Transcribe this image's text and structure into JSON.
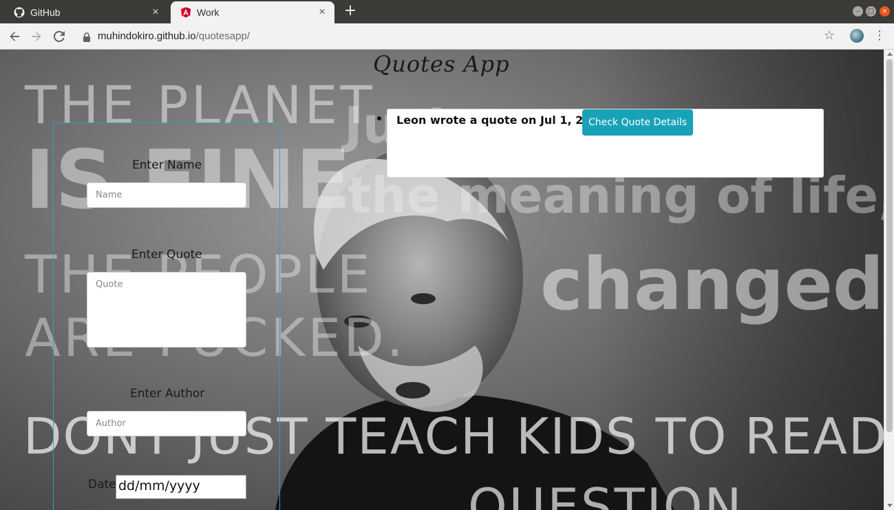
{
  "browser": {
    "tabs": [
      {
        "label": "GitHub",
        "icon": "github-icon"
      },
      {
        "label": "Work",
        "icon": "angular-icon"
      }
    ],
    "url_host": "muhindokiro.github.io",
    "url_path": "/quotesapp/",
    "new_tab_glyph": "+",
    "close_glyph": "×"
  },
  "page": {
    "title": "Quotes App",
    "background_text": {
      "line1": "THE PLANET",
      "line2": "IS FINE",
      "line3": "THE PEOPLE",
      "line4": "ARE FUCKED.",
      "line5": "DONT JUST TEACH KIDS TO READ",
      "line6": "QUESTION",
      "line7": "Just",
      "line8": "the meaning of life,",
      "line9": "changed"
    },
    "form": {
      "name_label": "Enter Name",
      "name_placeholder": "Name",
      "quote_label": "Enter Quote",
      "quote_placeholder": "Quote",
      "author_label": "Enter Author",
      "author_placeholder": "Author",
      "date_label": "Date",
      "date_value": "dd/mm/yyyy"
    },
    "quotes": [
      {
        "text": "Leon wrote a quote on Jul 1, 2019",
        "button_label": "Check Quote Details"
      }
    ]
  },
  "colors": {
    "accent": "#17a2b8",
    "form_border": "#2aa6b8",
    "close_window": "#e95420"
  }
}
